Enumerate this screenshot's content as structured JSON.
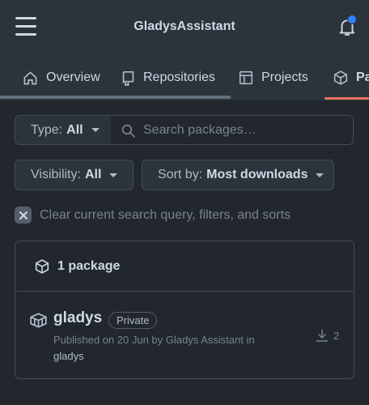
{
  "header": {
    "title": "GladysAssistant",
    "menu_icon": "hamburger-icon",
    "notification_icon": "bell-icon",
    "notification_dot_color": "#2f81f7"
  },
  "tabs": [
    {
      "label": "Overview",
      "icon": "home-icon"
    },
    {
      "label": "Repositories",
      "icon": "repo-icon"
    },
    {
      "label": "Projects",
      "icon": "table-icon"
    },
    {
      "label": "Pa",
      "icon": "package-icon",
      "selected": true
    }
  ],
  "filters": {
    "type_label": "Type:",
    "type_value": "All",
    "search_placeholder": "Search packages…",
    "visibility_label": "Visibility:",
    "visibility_value": "All",
    "sort_label": "Sort by:",
    "sort_value": "Most downloads",
    "clear_text": "Clear current search query, filters, and sorts"
  },
  "packages": {
    "count_label": "1 package",
    "items": [
      {
        "name": "gladys",
        "visibility": "Private",
        "published_prefix": "Published on 20 Jun by Gladys Assistant in",
        "repository": "gladys",
        "downloads": "2"
      }
    ]
  },
  "colors": {
    "accent_underline": "#ec775c",
    "background": "#22272e"
  }
}
